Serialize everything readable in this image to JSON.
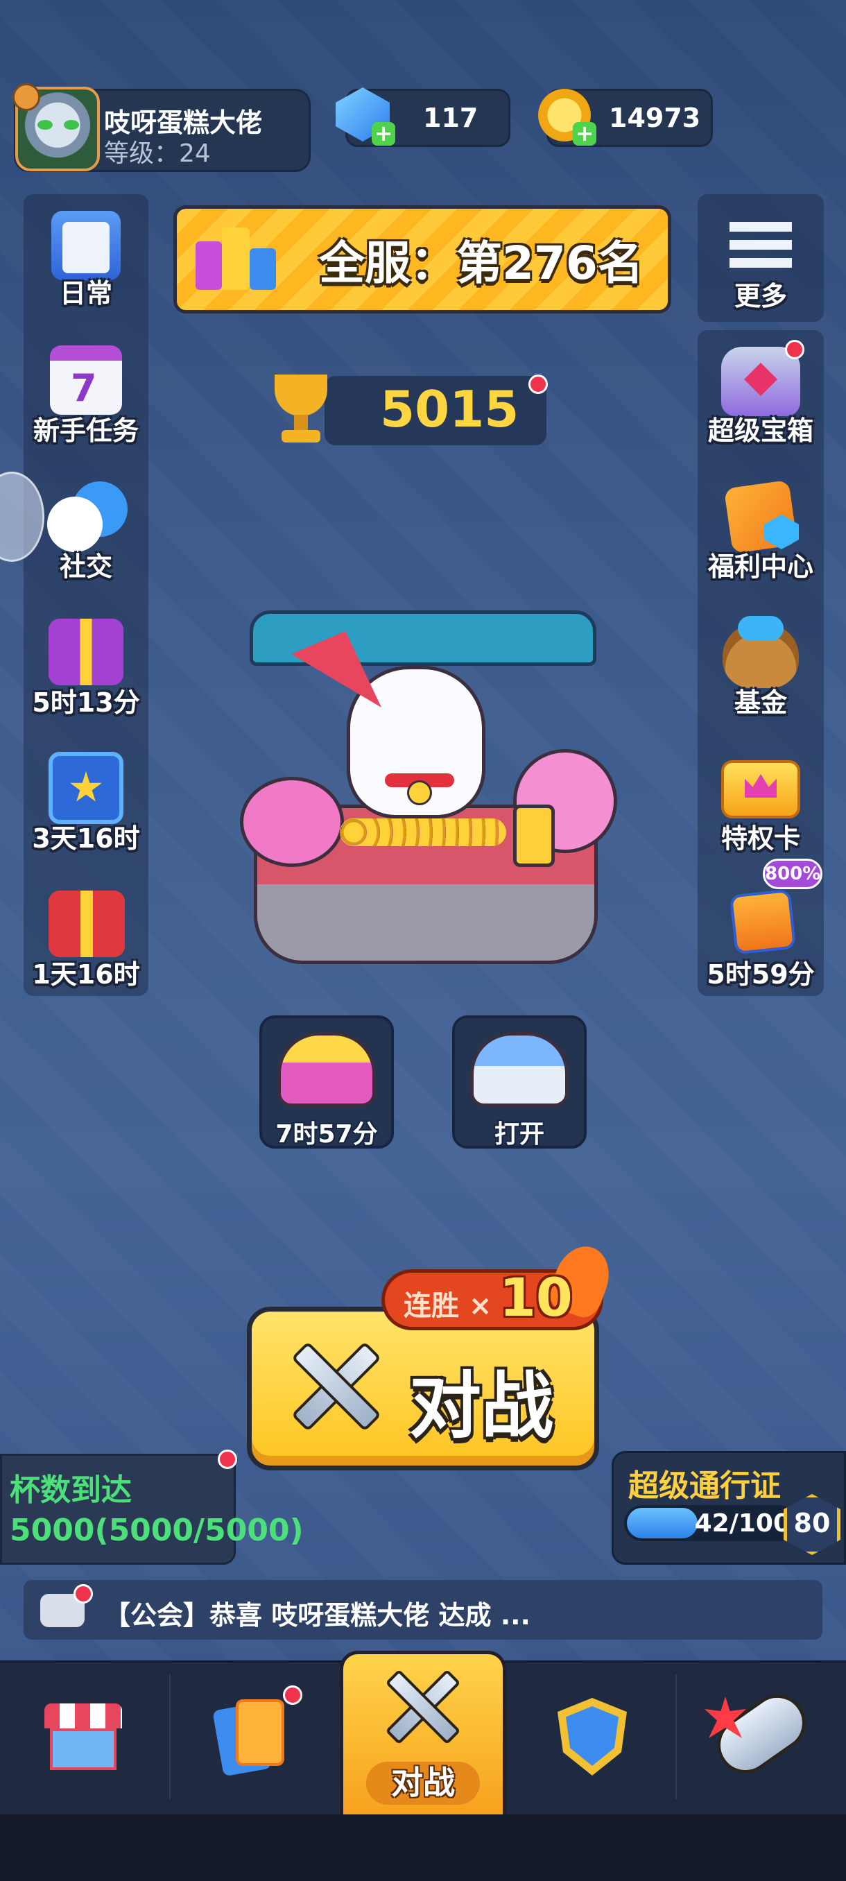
{
  "profile": {
    "name": "吱呀蛋糕大佬",
    "level": "等级：24"
  },
  "currencies": {
    "gems": "117",
    "coins": "14973"
  },
  "rank_banner": {
    "text": "全服：第276名"
  },
  "trophies": "5015",
  "left_menu": [
    {
      "label": "日常",
      "icon": "clipboard-icon"
    },
    {
      "label": "新手任务",
      "icon": "calendar-icon"
    },
    {
      "label": "社交",
      "icon": "chat-faces-icon"
    },
    {
      "label": "5时13分",
      "icon": "gift-box-icon"
    },
    {
      "label": "3天16时",
      "icon": "star-chest-icon"
    },
    {
      "label": "1天16时",
      "icon": "party-gift-icon"
    }
  ],
  "right_menu": [
    {
      "label": "更多",
      "icon": "menu-list-icon"
    },
    {
      "label": "超级宝箱",
      "icon": "super-chest-icon"
    },
    {
      "label": "福利中心",
      "icon": "welfare-cards-icon"
    },
    {
      "label": "基金",
      "icon": "fund-bag-icon"
    },
    {
      "label": "特权卡",
      "icon": "privilege-card-icon"
    },
    {
      "label": "5时59分",
      "icon": "card-offer-icon",
      "badge": "800%"
    }
  ],
  "chests": [
    {
      "label": "7时57分",
      "icon": "pink-chest-icon"
    },
    {
      "label": "打开",
      "icon": "blue-chest-icon"
    }
  ],
  "battle": {
    "label": "对战",
    "streak_label": "连胜 ×",
    "streak_value": "10"
  },
  "quest": {
    "text": "杯数到达5000(5000/5000)"
  },
  "pass": {
    "title": "超级通行证",
    "progress_text": "42/100",
    "progress_fraction": 0.42,
    "level": "80"
  },
  "chat": {
    "text": "【公会】恭喜 吱呀蛋糕大佬 达成 ..."
  },
  "nav": {
    "items": [
      {
        "icon": "shop-icon"
      },
      {
        "icon": "cards-icon"
      },
      {
        "icon": "battle-swords-icon",
        "label": "对战"
      },
      {
        "icon": "guild-shield-icon"
      },
      {
        "icon": "rocket-fist-icon"
      }
    ]
  },
  "colors": {
    "accent_yellow": "#ffc93a",
    "quest_green": "#4de07a",
    "notification_red": "#f0334c"
  }
}
